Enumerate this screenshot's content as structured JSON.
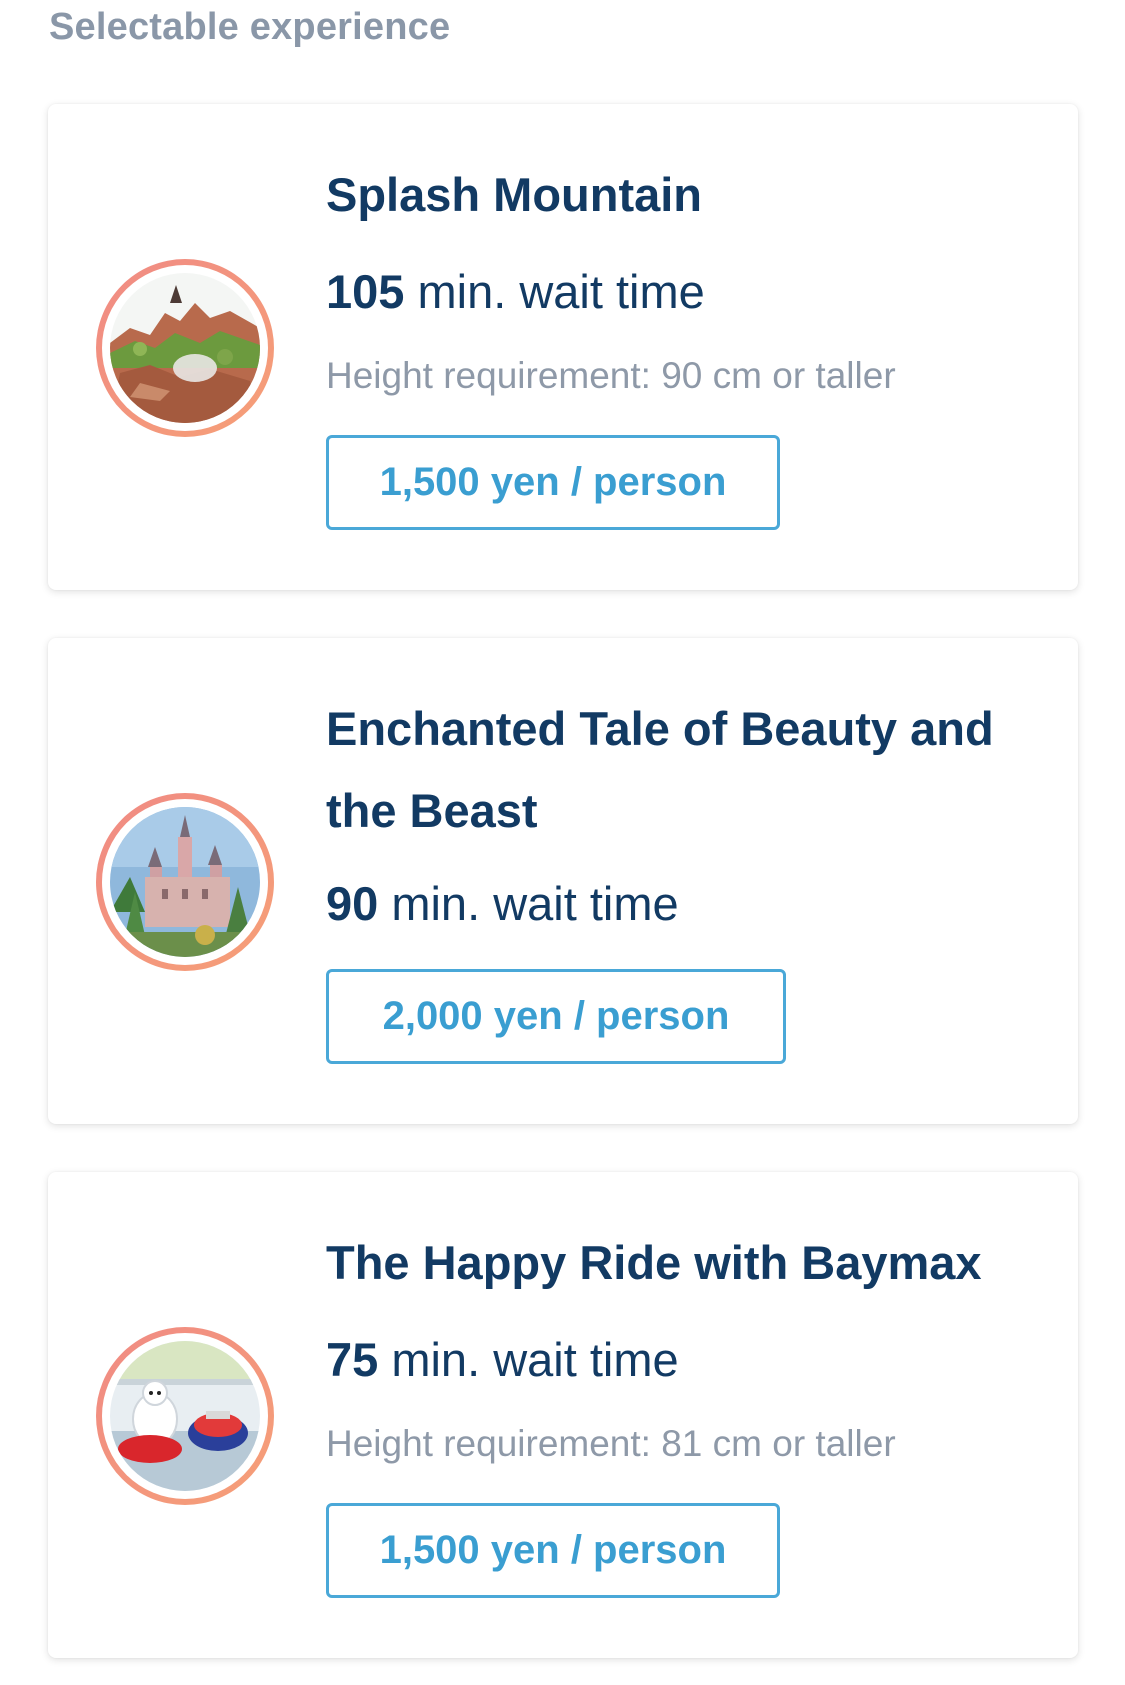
{
  "section": {
    "title": "Selectable experience"
  },
  "colors": {
    "title": "#123a63",
    "muted": "#8e99a8",
    "accent": "#3a9ed1",
    "thumb_ring": "#f08a84"
  },
  "experiences": [
    {
      "name": "Splash Mountain",
      "wait_minutes": "105",
      "wait_suffix": " min. wait time",
      "height_requirement": "Height requirement: 90 cm or taller",
      "price": "1,500 yen / person",
      "image_icon": "splash-mountain-photo"
    },
    {
      "name": "Enchanted Tale of Beauty and the Beast",
      "wait_minutes": "90",
      "wait_suffix": " min. wait time",
      "price": "2,000 yen / person",
      "image_icon": "beauty-beast-castle-photo"
    },
    {
      "name": "The Happy Ride with Baymax",
      "wait_minutes": "75",
      "wait_suffix": " min. wait time",
      "height_requirement": "Height requirement: 81 cm or taller",
      "price": "1,500 yen / person",
      "image_icon": "baymax-ride-photo"
    }
  ]
}
